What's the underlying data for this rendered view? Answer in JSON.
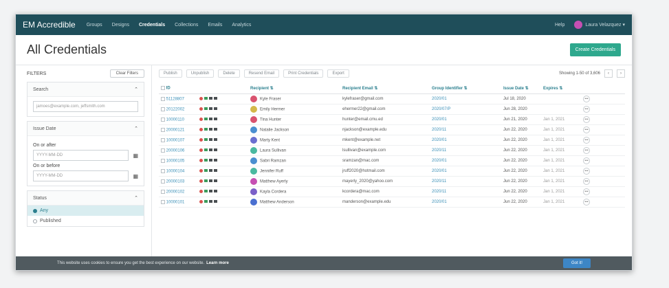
{
  "app": {
    "brand": "EM Accredible",
    "nav": [
      "Groups",
      "Designs",
      "Credentials",
      "Collections",
      "Emails",
      "Analytics"
    ],
    "active_nav": "Credentials",
    "help": "Help",
    "user": "Laura Velazquez"
  },
  "header": {
    "title": "All Credentials",
    "create_label": "Create Credentials"
  },
  "sidebar": {
    "filters_label": "FILTERS",
    "clear_label": "Clear Filters",
    "search": {
      "title": "Search",
      "placeholder": "jamoes@example.com, jeffsmith.com"
    },
    "issue_date": {
      "title": "Issue Date",
      "on_after_label": "On or after",
      "on_before_label": "On or before",
      "date_placeholder": "YYYY-MM-DD"
    },
    "status": {
      "title": "Status",
      "options": [
        "Any",
        "Published"
      ],
      "selected": "Any"
    }
  },
  "toolbar": {
    "buttons": [
      "Publish",
      "Unpublish",
      "Delete",
      "Resend Email",
      "Print Credentials",
      "Export"
    ],
    "showing": "Showing 1-50 of 3,606",
    "prev": "‹",
    "next": "›"
  },
  "table": {
    "columns": [
      "ID",
      "Recipient",
      "Recipient Email",
      "Group Identifier",
      "Issue Date",
      "Expires"
    ],
    "rows": [
      {
        "id": "51128807",
        "name": "Kyle Fraser",
        "email": "kylefraser@gmail.com",
        "group": "2020/01",
        "issue": "Jul 18, 2020",
        "expires": "",
        "color": "#d9536f"
      },
      {
        "id": "20122002",
        "name": "Emily Hermer",
        "email": "ehermer22@gmail.com",
        "group": "2020/07/P",
        "issue": "Jun 28, 2020",
        "expires": "",
        "color": "#d4b84a"
      },
      {
        "id": "10000110",
        "name": "Tina Hunter",
        "email": "hunter@email.cmu.ed",
        "group": "2020/01",
        "issue": "Jun 21, 2020",
        "expires": "Jan 1, 2021",
        "color": "#d9536f"
      },
      {
        "id": "20000121",
        "name": "Natalie Jackson",
        "email": "njackson@example.edu",
        "group": "2020/11",
        "issue": "Jun 22, 2020",
        "expires": "Jan 1, 2021",
        "color": "#4a8fd0"
      },
      {
        "id": "10000107",
        "name": "Marty Kent",
        "email": "mkent@example.net",
        "group": "2020/01",
        "issue": "Jun 22, 2020",
        "expires": "Jan 1, 2021",
        "color": "#6a6fd0"
      },
      {
        "id": "20000106",
        "name": "Laura Sullivan",
        "email": "lsullivan@example.com",
        "group": "2020/11",
        "issue": "Jun 22, 2020",
        "expires": "Jan 1, 2021",
        "color": "#4ab9a0"
      },
      {
        "id": "10000105",
        "name": "Sabri Ramzan",
        "email": "sramzan@mac.com",
        "group": "2020/01",
        "issue": "Jun 22, 2020",
        "expires": "Jan 1, 2021",
        "color": "#4a8fd0"
      },
      {
        "id": "10000104",
        "name": "Jennifer Ruff",
        "email": "jruff2020@hotmail.com",
        "group": "2020/01",
        "issue": "Jun 22, 2020",
        "expires": "Jan 1, 2021",
        "color": "#4ab9a0"
      },
      {
        "id": "20000103",
        "name": "Matthew Ayerly",
        "email": "mayerly_2020@yahoo.com",
        "group": "2020/11",
        "issue": "Jun 22, 2020",
        "expires": "Jan 1, 2021",
        "color": "#c64fb3"
      },
      {
        "id": "20000102",
        "name": "Kayla Cordera",
        "email": "kcordera@mac.com",
        "group": "2020/11",
        "issue": "Jun 22, 2020",
        "expires": "Jan 1, 2021",
        "color": "#7a5fc8"
      },
      {
        "id": "10000101",
        "name": "Matthew Anderson",
        "email": "manderson@example.edu",
        "group": "2020/01",
        "issue": "Jun 22, 2020",
        "expires": "Jan 1, 2021",
        "color": "#4a6fd0"
      }
    ]
  },
  "cookie": {
    "message": "This website uses cookies to ensure you get the best experience on our website.",
    "learn_more": "Learn more",
    "got_it": "Got it!"
  }
}
